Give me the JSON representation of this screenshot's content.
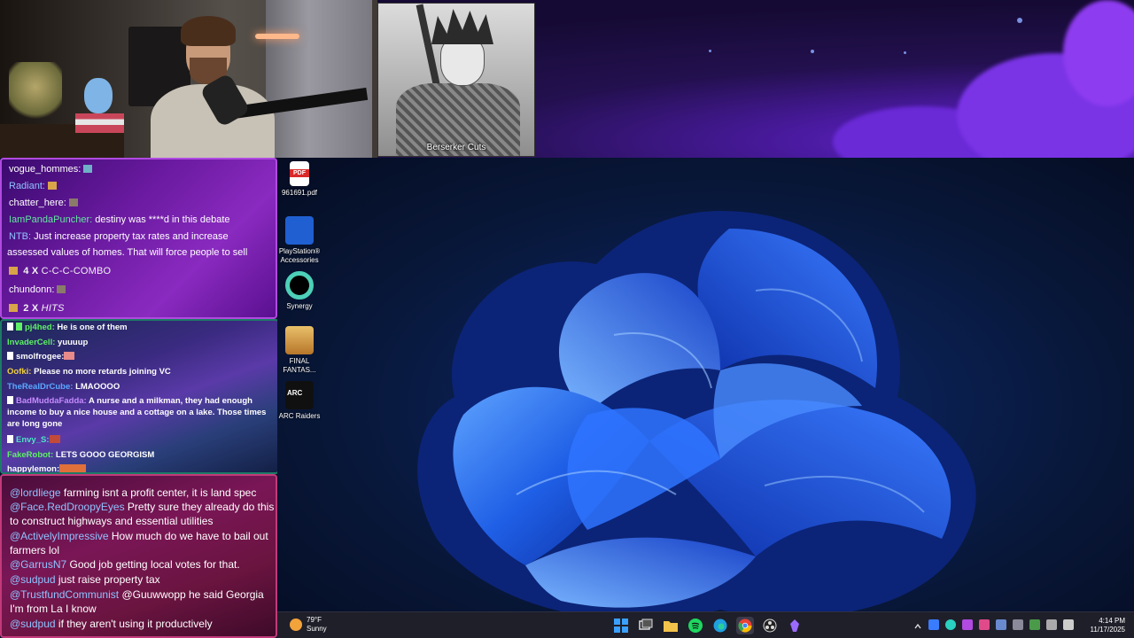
{
  "overlay": {
    "manga_caption": "Berserker Cuts"
  },
  "chat_top": {
    "lines": [
      {
        "user": "vogue_hommes:",
        "text": ""
      },
      {
        "user": "Radiant:",
        "text": ""
      },
      {
        "user": "chatter_here:",
        "text": ""
      },
      {
        "user": "IamPandaPuncher:",
        "text": " destiny was ****d in this debate"
      },
      {
        "user": "NTB:",
        "text": " Just increase property tax rates and increase"
      },
      {
        "user": "",
        "text": "assessed values of homes. That will force people to sell"
      },
      {
        "user": "chundonn:",
        "text": ""
      }
    ],
    "combo1": {
      "count": "4",
      "x": "X",
      "label": "C-C-C-COMBO"
    },
    "combo2": {
      "count": "2",
      "x": "X",
      "label": "HITS"
    }
  },
  "chat_mid": {
    "lines": [
      {
        "user": "pj4hed:",
        "text": " He is one of them"
      },
      {
        "user": "InvaderCell:",
        "text": " yuuuup"
      },
      {
        "user": "smolfrogee:",
        "text": ""
      },
      {
        "user": "Oofki:",
        "text": " Please no more retards joining VC"
      },
      {
        "user": "TheRealDrCube:",
        "text": " LMAOOOO"
      },
      {
        "user": "BadMuddaFadda:",
        "text": " A nurse and a milkman, they had enough income to buy a nice house and a cottage on a lake. Those times are long gone"
      },
      {
        "user": "Envy_S:",
        "text": ""
      },
      {
        "user": "FakeRobot:",
        "text": " LETS GOOO GEORGISM"
      },
      {
        "user": "happylemon:",
        "text": ""
      }
    ]
  },
  "chat_bottom": {
    "lines": [
      {
        "mention": "@lordliege",
        "text": " farming isnt a profit center, it is land spec"
      },
      {
        "mention": "@Face.RedDroopyEyes",
        "text": " Pretty sure they already do this to construct highways and essential utilities"
      },
      {
        "mention": "@ActivelyImpressive",
        "text": " How much do we have to bail out farmers lol"
      },
      {
        "mention": "@GarrusN7",
        "text": " Good job getting local votes for that."
      },
      {
        "mention": "@sudpud",
        "text": " just raise property tax"
      },
      {
        "mention": "@TrustfundCommunist",
        "text": " @Guuwwopp he said Georgia I'm from La I know"
      },
      {
        "mention": "@sudpud",
        "text": " if they aren't using it productively"
      }
    ]
  },
  "desktop": {
    "icons": [
      {
        "label": "961691.pdf",
        "icon": "pdf-file-icon"
      },
      {
        "label": "PlayStation® Accessories",
        "icon": "playstation-icon"
      },
      {
        "label": "Synergy",
        "icon": "synergy-icon"
      },
      {
        "label": "FINAL FANTAS...",
        "icon": "final-fantasy-icon"
      },
      {
        "label": "ARC Raiders",
        "icon": "arc-raiders-icon"
      }
    ],
    "pdf_badge": "PDF",
    "arc_badge": "ARC"
  },
  "taskbar": {
    "weather_temp": "79°F",
    "weather_cond": "Sunny",
    "time": "4:14 PM",
    "date": "11/17/2025",
    "accent": "#0078d4"
  }
}
